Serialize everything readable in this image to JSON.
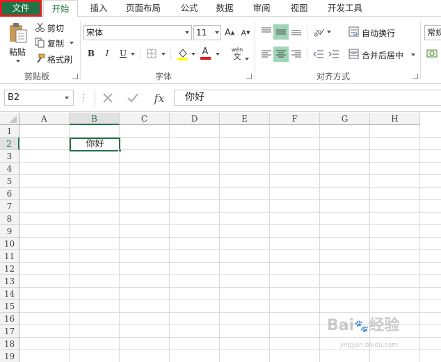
{
  "tabs": {
    "file": "文件",
    "home": "开始",
    "insert": "插入",
    "page_layout": "页面布局",
    "formulas": "公式",
    "data": "数据",
    "review": "审阅",
    "view": "视图",
    "developer": "开发工具"
  },
  "clipboard": {
    "paste": "粘贴",
    "cut": "剪切",
    "copy": "复制",
    "format_painter": "格式刷",
    "group_label": "剪贴板"
  },
  "font": {
    "name": "宋体",
    "size": "11",
    "bold": "B",
    "italic": "I",
    "underline": "U",
    "phonetic": "wén",
    "phonetic_char": "文",
    "group_label": "字体",
    "grow": "A",
    "shrink": "A",
    "font_color_letter": "A"
  },
  "alignment": {
    "wrap_text": "自动换行",
    "merge_center": "合并后居中",
    "group_label": "对齐方式"
  },
  "number": {
    "format": "常规"
  },
  "formula_bar": {
    "name_box": "B2",
    "fx": "fx",
    "content": "你好"
  },
  "columns": [
    "A",
    "B",
    "C",
    "D",
    "E",
    "F",
    "G",
    "H"
  ],
  "rows": [
    "1",
    "2",
    "3",
    "4",
    "5",
    "6",
    "7",
    "8",
    "9",
    "10",
    "11",
    "12",
    "13",
    "14",
    "15",
    "16",
    "17",
    "18",
    "19"
  ],
  "cells": {
    "B2": "你好"
  },
  "watermark": {
    "main": "Bai\u0000经验",
    "sub": "jingyan.baidu.com"
  },
  "colors": {
    "excel_green": "#217346",
    "highlight": "#e02020",
    "selected_align": "#9fd5b7"
  }
}
